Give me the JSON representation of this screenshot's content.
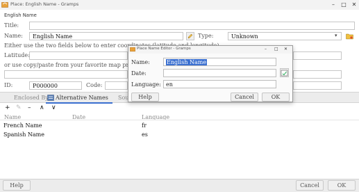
{
  "window": {
    "title": "Place: English Name - Gramps",
    "minimize": "–",
    "maximize": "□",
    "close": "✕"
  },
  "header_label": "English Name",
  "form": {
    "title_label": "Title:",
    "title_value": "",
    "name_label": "Name:",
    "name_value": "English Name",
    "type_label": "Type:",
    "type_value": "Unknown",
    "coords_hint": "Either use the two fields below to enter coordinates (latitude and longitude),",
    "latitude_label": "Latitude:",
    "latitude_value": "",
    "copy_hint": "or use copy/paste from your favorite map provider",
    "id_label": "ID:",
    "id_value": "P000000",
    "code_label": "Code:",
    "code_value": ""
  },
  "tabs": [
    {
      "label": "Enclosed By"
    },
    {
      "label": "Alternative Names"
    },
    {
      "label": "Sou"
    }
  ],
  "toolbar": {
    "add": "+",
    "edit": "✎",
    "remove": "–",
    "up": "∧",
    "down": "∨"
  },
  "alt_names_table": {
    "headers": [
      "Name",
      "Date",
      "Language"
    ],
    "rows": [
      {
        "name": "French Name",
        "date": "",
        "language": "fr"
      },
      {
        "name": "Spanish Name",
        "date": "",
        "language": "es"
      }
    ]
  },
  "bottom": {
    "help": "Help",
    "cancel": "Cancel",
    "ok": "OK"
  },
  "dialog": {
    "title": "Place Name Editor - Gramps",
    "minimize": "–",
    "maximize": "□",
    "close": "✕",
    "name_label": "Name:",
    "name_value": "English Name",
    "date_label": "Date:",
    "date_value": "",
    "language_label": "Language:",
    "language_value": "en",
    "help": "Help",
    "cancel": "Cancel",
    "ok": "OK"
  },
  "colors": {
    "selection": "#3a6fd0",
    "tabbar": "#ececec"
  }
}
